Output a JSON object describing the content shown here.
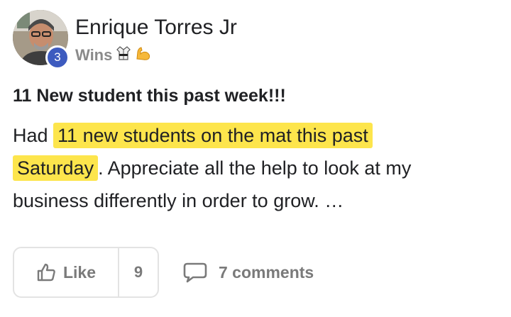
{
  "author": {
    "name": "Enrique Torres Jr",
    "level": "3",
    "category": "Wins",
    "category_icons": [
      "martial-arts-uniform-icon",
      "flexed-biceps-icon"
    ]
  },
  "post": {
    "title": "11 New student this past week!!!",
    "body_prefix": "Had",
    "body_highlight_1": "11 new students on the mat this past",
    "body_highlight_2": "Saturday",
    "body_suffix": ". Appreciate all the help to look at my business differently in order to grow. …"
  },
  "actions": {
    "like_label": "Like",
    "like_count": "9",
    "comments_label": "7 comments"
  },
  "colors": {
    "highlight": "#fde54c",
    "level_badge": "#3d5bbf",
    "muted_text": "#7a7a7a"
  }
}
